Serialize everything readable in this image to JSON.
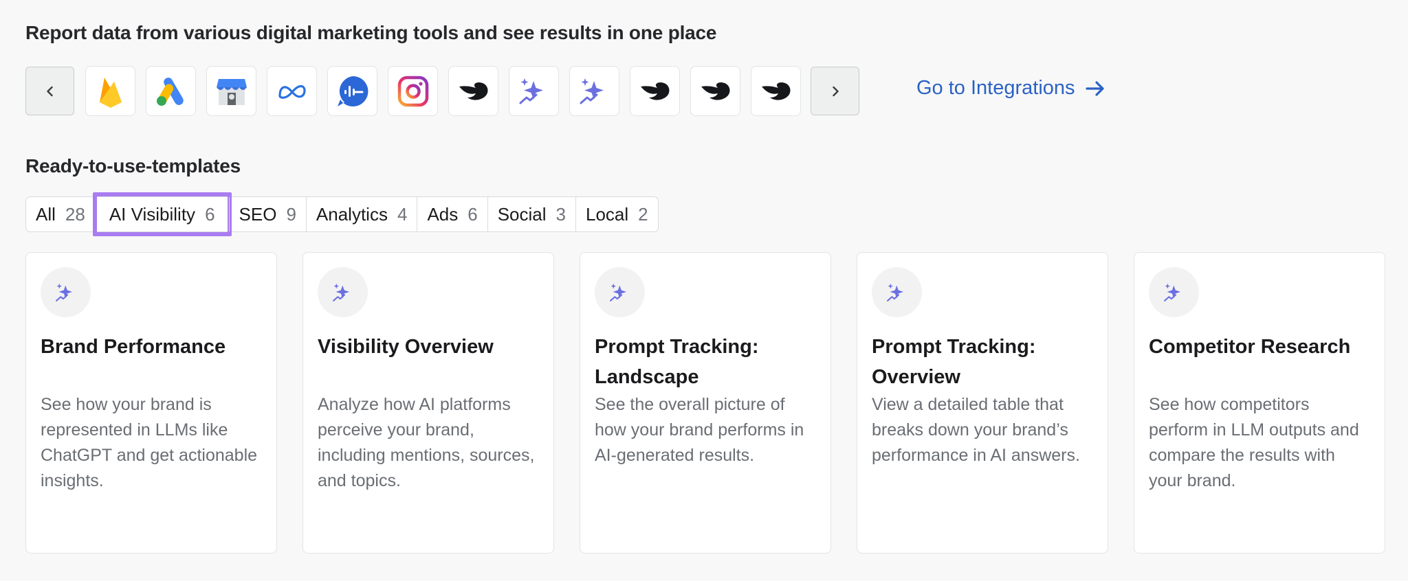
{
  "integrations": {
    "heading": "Report data from various digital marketing tools and see results in one place",
    "tiles": [
      "firebase-icon",
      "google-ads-icon",
      "google-business-icon",
      "meta-icon",
      "ai-chat-icon",
      "instagram-icon",
      "semrush-icon",
      "sparkle-icon",
      "sparkle-icon",
      "semrush-icon",
      "semrush-icon",
      "semrush-icon"
    ],
    "go_link": "Go to Integrations",
    "colors": {
      "link": "#2b62c4",
      "sparkle": "#6b6fe0"
    }
  },
  "templates": {
    "heading": "Ready-to-use-templates",
    "filters": [
      {
        "label": "All",
        "count": "28"
      },
      {
        "label": "AI Visibility",
        "count": "6",
        "active": true
      },
      {
        "label": "SEO",
        "count": "9"
      },
      {
        "label": "Analytics",
        "count": "4"
      },
      {
        "label": "Ads",
        "count": "6"
      },
      {
        "label": "Social",
        "count": "3"
      },
      {
        "label": "Local",
        "count": "2"
      }
    ],
    "cards": [
      {
        "title": "Brand Performance",
        "description": "See how your brand is represented in LLMs like ChatGPT and get actionable insights."
      },
      {
        "title": "Visibility Overview",
        "description": "Analyze how AI platforms perceive your brand, including mentions, sources, and topics."
      },
      {
        "title": "Prompt Tracking: Landscape",
        "description": "See the overall picture of how your brand performs in AI-generated results."
      },
      {
        "title": "Prompt Tracking: Overview",
        "description": "View a detailed table that breaks down your brand’s performance in AI answers."
      },
      {
        "title": "Competitor Research",
        "description": "See how competitors perform in LLM outputs and compare the results with your brand."
      }
    ]
  }
}
